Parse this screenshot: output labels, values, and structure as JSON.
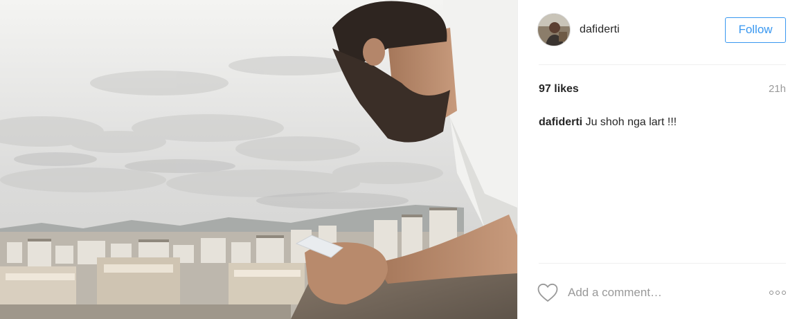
{
  "post": {
    "image": {
      "subject": "man-looking-at-phone-over-city-rooftops"
    },
    "author": {
      "username": "dafiderti"
    },
    "follow_label": "Follow",
    "likes": "97 likes",
    "time_ago": "21h",
    "caption": {
      "username": "dafiderti",
      "text": "Ju shoh nga lart !!!"
    },
    "comment_placeholder": "Add a comment…",
    "icons": {
      "like": "heart-icon",
      "more": "more-options-icon"
    }
  },
  "colors": {
    "accent": "#3897f0",
    "text": "#262626",
    "muted": "#999999",
    "divider": "#efefef"
  }
}
